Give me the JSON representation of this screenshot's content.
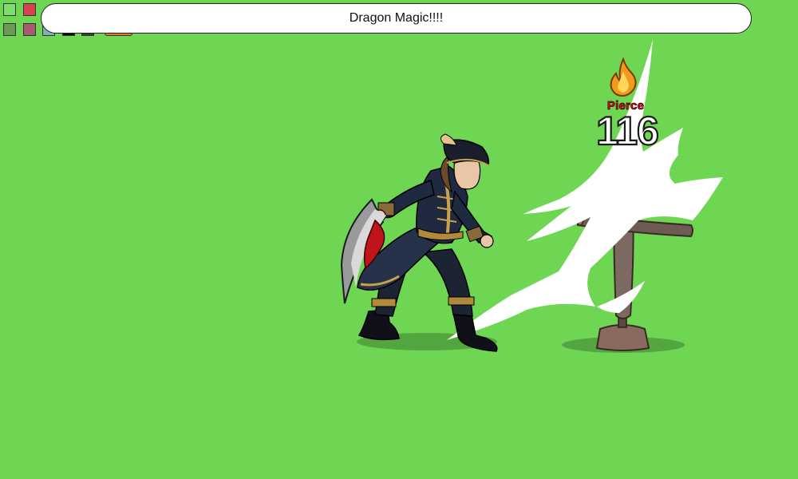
{
  "message": "Dragon Magic!!!!",
  "damage": {
    "type": "Pierce",
    "value": "116",
    "icon": "fire-icon"
  },
  "swatches": {
    "colors": [
      "#7be06a",
      "#d8414f",
      "#6a9a55",
      "#a85a74",
      "#7fb0b8",
      "#0a0a0a",
      "#3a3a3a",
      "#e07a30"
    ]
  },
  "scene": {
    "background_color": "#6ed653",
    "player": "pirate-hero",
    "target": "training-dummy"
  }
}
